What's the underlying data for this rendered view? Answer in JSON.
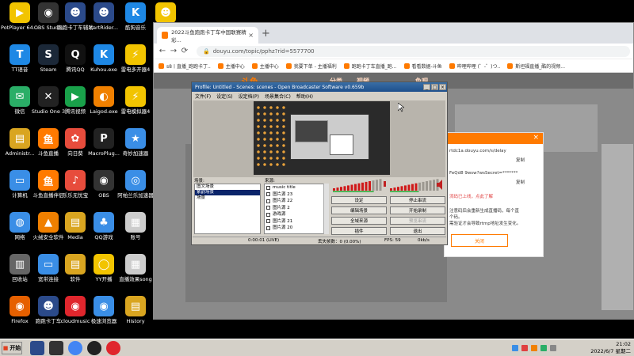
{
  "desktop": {
    "icons": [
      {
        "label": "PotPlayer 64 bit",
        "glyph": "▶",
        "color": "#f2c400"
      },
      {
        "label": "OBS Studio",
        "glyph": "◉",
        "color": "#333333"
      },
      {
        "label": "跑跑卡丁车辅助",
        "glyph": "☻",
        "color": "#2b4a8a"
      },
      {
        "label": "KartRider...",
        "glyph": "☻",
        "color": "#2b4a8a"
      },
      {
        "label": "酷狗音乐",
        "glyph": "K",
        "color": "#1e88e5"
      },
      {
        "label": "",
        "glyph": "☻",
        "color": "#f2c400"
      },
      {
        "label": "TT语音",
        "glyph": "T",
        "color": "#1e88e5"
      },
      {
        "label": "Steam",
        "glyph": "S",
        "color": "#1b2838"
      },
      {
        "label": "腾讯QQ",
        "glyph": "Q",
        "color": "#111111"
      },
      {
        "label": "Kuhou.exe",
        "glyph": "K",
        "color": "#1e88e5"
      },
      {
        "label": "雷电多开器4",
        "glyph": "⚡",
        "color": "#f2c400"
      },
      {
        "label": "微信",
        "glyph": "✉",
        "color": "#2aae67"
      },
      {
        "label": "Studio One 3",
        "glyph": "✕",
        "color": "#222222"
      },
      {
        "label": "腾讯视频",
        "glyph": "▶",
        "color": "#19a14a"
      },
      {
        "label": "Laigod.exe",
        "glyph": "◐",
        "color": "#f08000"
      },
      {
        "label": "雷电模拟器4",
        "glyph": "⚡",
        "color": "#f2c400"
      },
      {
        "label": "Administr...",
        "glyph": "▤",
        "color": "#d9a520"
      },
      {
        "label": "斗鱼直播",
        "glyph": "鱼",
        "color": "#ff7a00"
      },
      {
        "label": "向日葵",
        "glyph": "✿",
        "color": "#e74c3c"
      },
      {
        "label": "MacroPlug...",
        "glyph": "P",
        "color": "#222222"
      },
      {
        "label": "奇妙加速器",
        "glyph": "★",
        "color": "#3a8ee6"
      },
      {
        "label": "计算机",
        "glyph": "▭",
        "color": "#3a8ee6"
      },
      {
        "label": "斗鱼直播伴侣",
        "glyph": "鱼",
        "color": "#ff7a00"
      },
      {
        "label": "乐乐无忧宝",
        "glyph": "♪",
        "color": "#e74c3c"
      },
      {
        "label": "OBS",
        "glyph": "◉",
        "color": "#333333"
      },
      {
        "label": "阿帕兰乐加速器",
        "glyph": "◎",
        "color": "#3a8ee6"
      },
      {
        "label": "网络",
        "glyph": "◍",
        "color": "#3a8ee6"
      },
      {
        "label": "火绒安全软件",
        "glyph": "▲",
        "color": "#f08000"
      },
      {
        "label": "Media",
        "glyph": "▤",
        "color": "#d9a520"
      },
      {
        "label": "QQ游戏",
        "glyph": "♣",
        "color": "#3a8ee6"
      },
      {
        "label": "账号",
        "glyph": "▦",
        "color": "#cccccc"
      },
      {
        "label": "回收站",
        "glyph": "▥",
        "color": "#666666"
      },
      {
        "label": "宽带连接",
        "glyph": "▭",
        "color": "#3a8ee6"
      },
      {
        "label": "软件",
        "glyph": "▤",
        "color": "#d9a520"
      },
      {
        "label": "YY开播",
        "glyph": "◯",
        "color": "#f2c400"
      },
      {
        "label": "直播效果song",
        "glyph": "▦",
        "color": "#cccccc"
      },
      {
        "label": "Firefox",
        "glyph": "◉",
        "color": "#e66000"
      },
      {
        "label": "跑跑卡丁车",
        "glyph": "☻",
        "color": "#2b4a8a"
      },
      {
        "label": "cloudmusic",
        "glyph": "◉",
        "color": "#e0262d"
      },
      {
        "label": "极速浏览器",
        "glyph": "◉",
        "color": "#3a8ee6"
      },
      {
        "label": "History",
        "glyph": "▤",
        "color": "#d9a520"
      }
    ]
  },
  "browser": {
    "tab_title": "2022斗鱼跑跑卡丁车中国联赛精彩...",
    "tab_close": "×",
    "new_tab": "+",
    "url": "douyu.com/topic/pphz?rid=5577700",
    "nav": {
      "back": "←",
      "forward": "→",
      "reload": "⟳"
    },
    "bookmarks": [
      "s8丨直播_跑跑卡丁..",
      "主播中心",
      "主播中心",
      "我要下单 - 主播福利",
      "跑跑卡丁车直播_跑...",
      "看看数据-斗鱼",
      "哔哩哔哩 (゜-゜)つ..",
      "斯坦福直播_酷的视频..."
    ],
    "site_nav": [
      "分类",
      "视频",
      "鱼吧"
    ],
    "dialog": {
      "close": "×",
      "line1": "rtdc1a.douyu.com/s/delay",
      "line2": "FeQd8 9wsw?wsSecret=*******",
      "copy1": "复制",
      "copy2": "复制",
      "warn": "流码已上线，点此了解",
      "note1": "注意码后会重新生成直播码，每个直",
      "note2": "个码。",
      "note3": "需验证才会导致rtmp地址发生变化。",
      "close_button": "关闭"
    }
  },
  "obs": {
    "title": "Profile: Untitled - Scenes: scenes - Open Broadcaster Software v0.659b",
    "window_buttons": [
      "_",
      "□",
      "×"
    ],
    "menu": [
      "文件(F)",
      "设定(S)",
      "设定档(P)",
      "场景集合(C)",
      "帮助(H)"
    ],
    "scenes_label": "场景:",
    "sources_label": "来源:",
    "scenes": [
      "图文场景",
      "紫韵场景",
      "场景"
    ],
    "selected_scene_index": 1,
    "sources": [
      "music title",
      "图片源 23",
      "图片源 22",
      "图片源 2",
      "游戏源",
      "图片源 21",
      "图片源 20"
    ],
    "buttons": {
      "settings": "设定",
      "stop_stream": "停止串流",
      "edit_scene": "编辑场景",
      "start_record": "开始录制",
      "global_sources": "全域来源",
      "preview_stream": "预览串流",
      "plugins": "插件",
      "exit": "退出"
    },
    "status": {
      "time": "0:00:01 (LIVE)",
      "dropped": "丢失帧数：0 (0.00%)",
      "fps": "FPS: 59",
      "bitrate": "0kb/s"
    },
    "meter_levels": {
      "mic": 0.82,
      "desktop": 0.58
    }
  },
  "taskbar": {
    "start": "开始",
    "clock_time": "21:02",
    "clock_date": "2022/6/7 星期二"
  }
}
